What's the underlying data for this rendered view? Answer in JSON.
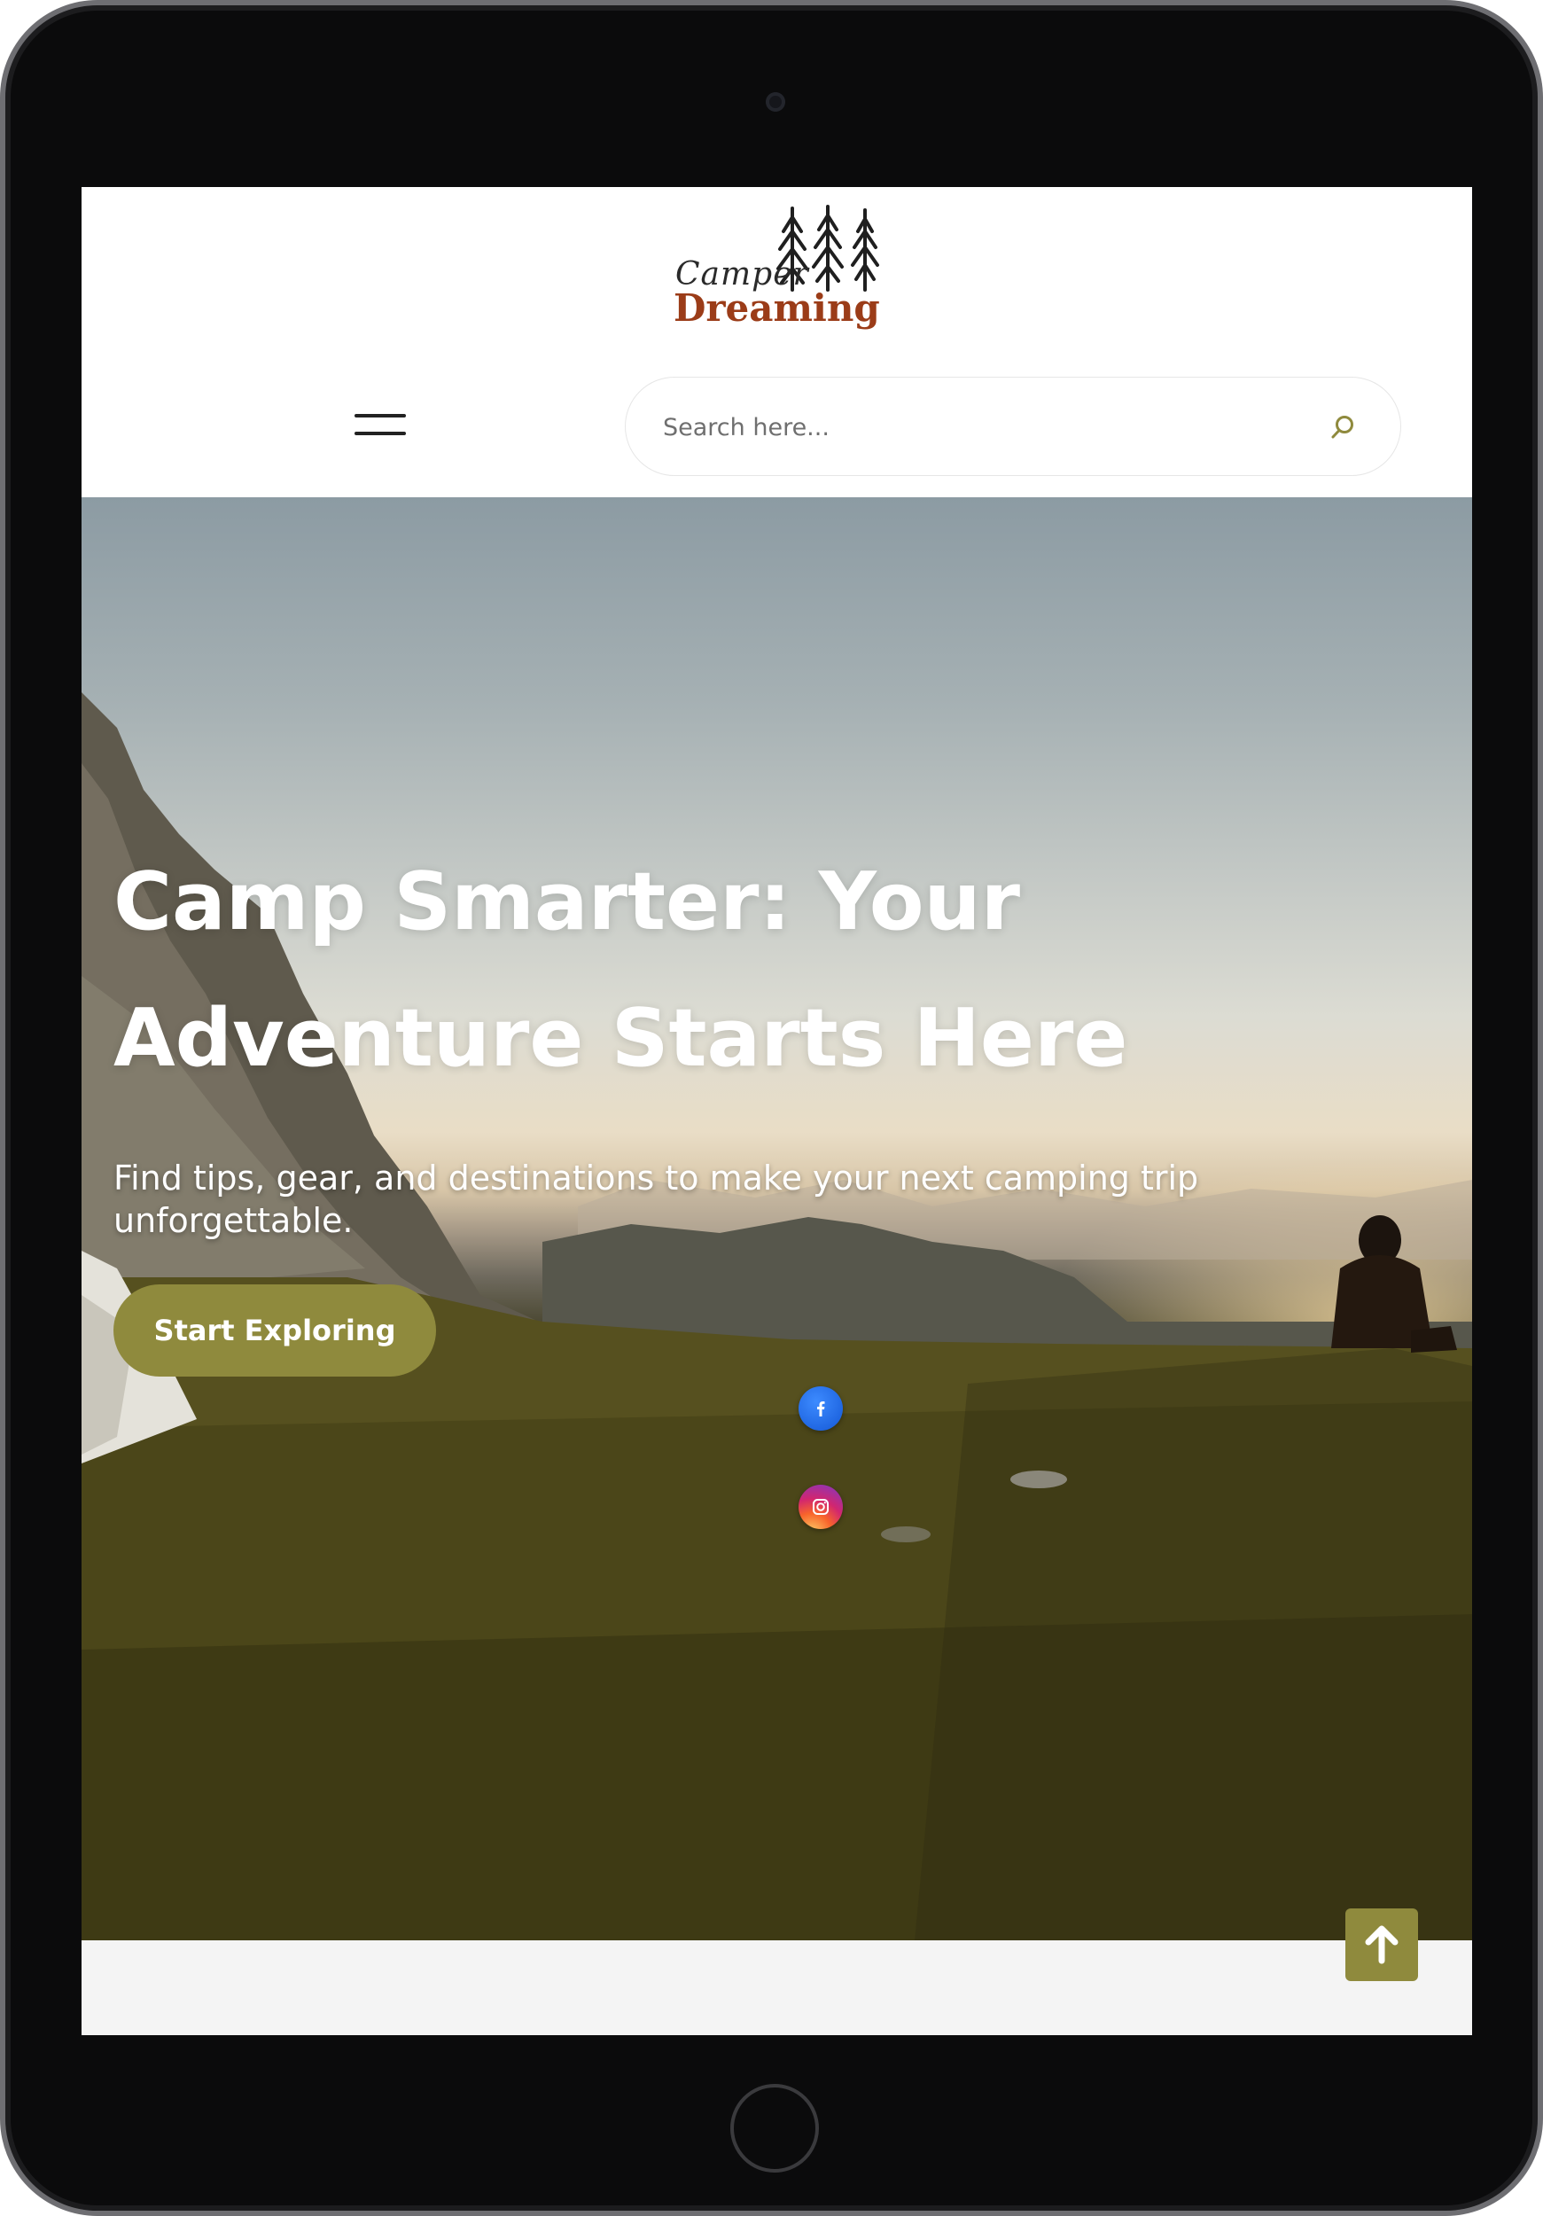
{
  "header": {
    "logo": {
      "word_top": "Camper",
      "word_bottom": "Dreaming",
      "icon": "pine-trees-icon"
    },
    "menu_icon": "hamburger-menu-icon",
    "search": {
      "placeholder": "Search here...",
      "value": "",
      "icon": "search-icon"
    }
  },
  "hero": {
    "title": "Camp Smarter: Your Adventure Starts Here",
    "subtitle": "Find tips, gear, and destinations to make your next camping trip unforgettable.",
    "cta_label": "Start Exploring",
    "social": [
      {
        "name": "facebook",
        "icon": "facebook-icon"
      },
      {
        "name": "instagram",
        "icon": "instagram-icon"
      }
    ]
  },
  "back_to_top": {
    "icon": "arrow-up-icon"
  },
  "colors": {
    "accent": "#8f8a3d",
    "logo_brown": "#9b3c18",
    "device_frame": "#0b0b0c"
  }
}
